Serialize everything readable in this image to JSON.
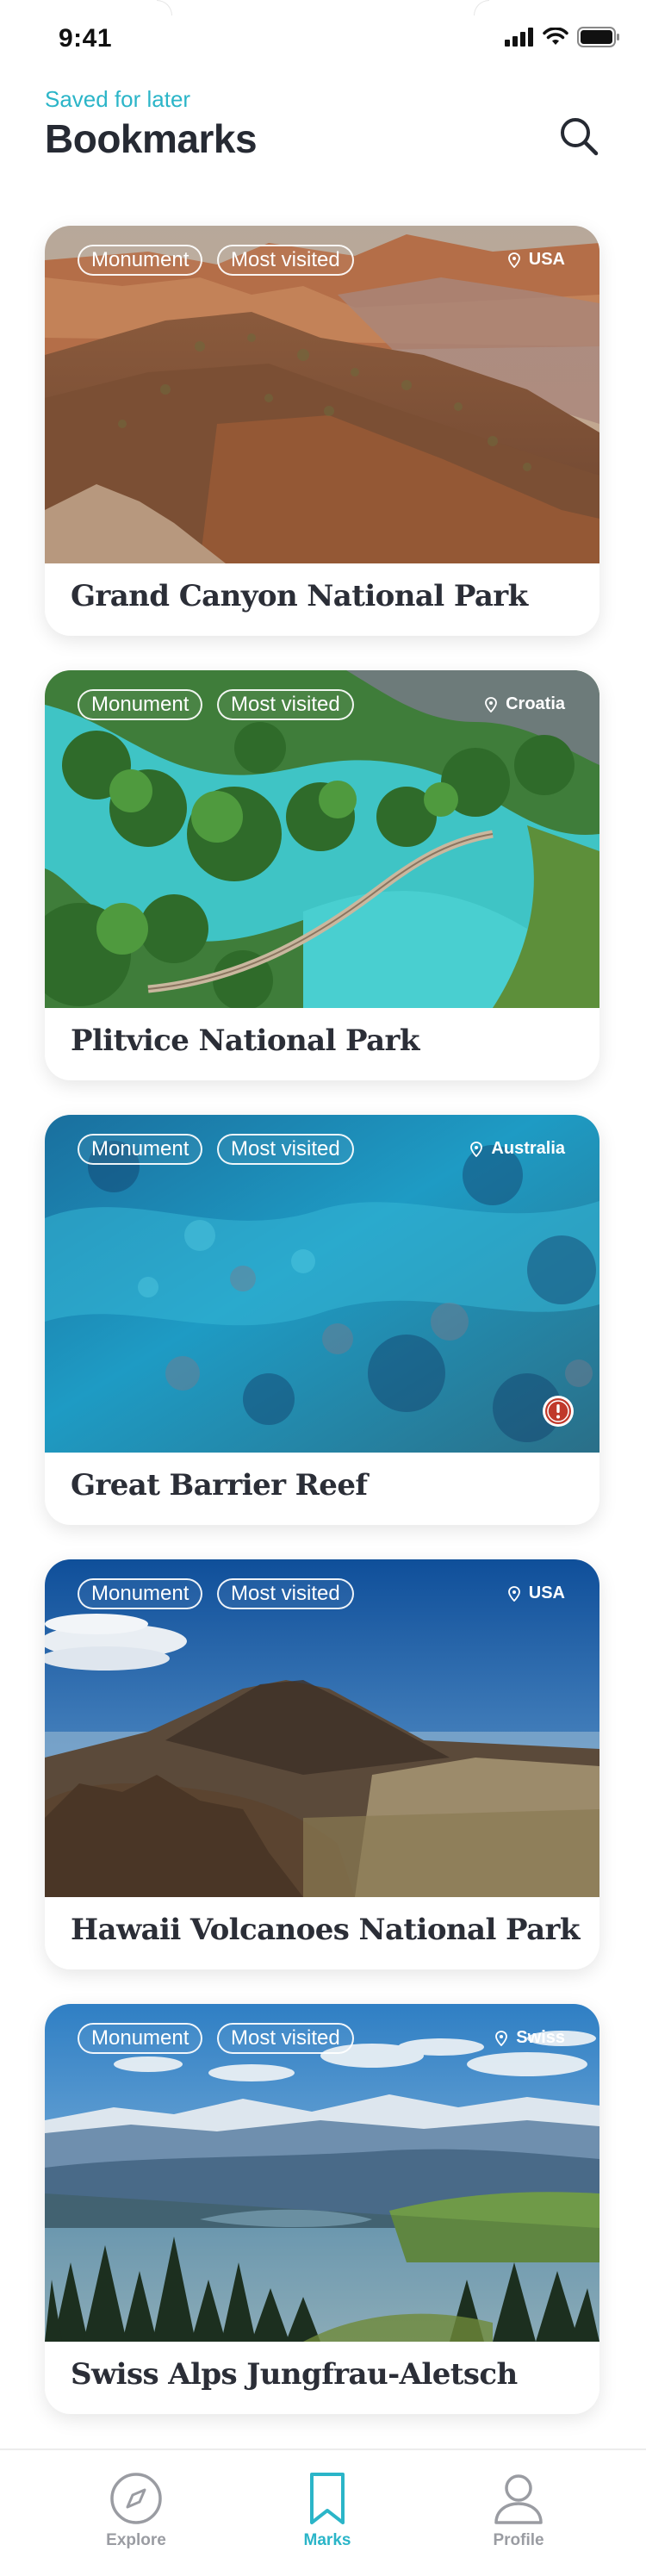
{
  "status_bar": {
    "time": "9:41"
  },
  "header": {
    "subtitle": "Saved for later",
    "title": "Bookmarks",
    "search_icon": "search-icon"
  },
  "colors": {
    "accent": "#2bb5c8",
    "title": "#262a33",
    "inactive": "#9a9ca2",
    "alert": "#c0392b"
  },
  "cards": [
    {
      "title": "Grand Canyon National Park",
      "tags": [
        "Monument",
        "Most visited"
      ],
      "location": "USA",
      "alert": false
    },
    {
      "title": "Plitvice National Park",
      "tags": [
        "Monument",
        "Most visited"
      ],
      "location": "Croatia",
      "alert": false
    },
    {
      "title": "Great Barrier Reef",
      "tags": [
        "Monument",
        "Most visited"
      ],
      "location": "Australia",
      "alert": true
    },
    {
      "title": "Hawaii Volcanoes National Park",
      "tags": [
        "Monument",
        "Most visited"
      ],
      "location": "USA",
      "alert": false
    },
    {
      "title": "Swiss Alps Jungfrau-Aletsch",
      "tags": [
        "Monument",
        "Most visited"
      ],
      "location": "Swiss",
      "alert": false
    }
  ],
  "tab_bar": {
    "tabs": [
      {
        "label": "Explore",
        "icon": "compass-icon",
        "active": false
      },
      {
        "label": "Marks",
        "icon": "bookmark-icon",
        "active": true
      },
      {
        "label": "Profile",
        "icon": "user-icon",
        "active": false
      }
    ]
  }
}
